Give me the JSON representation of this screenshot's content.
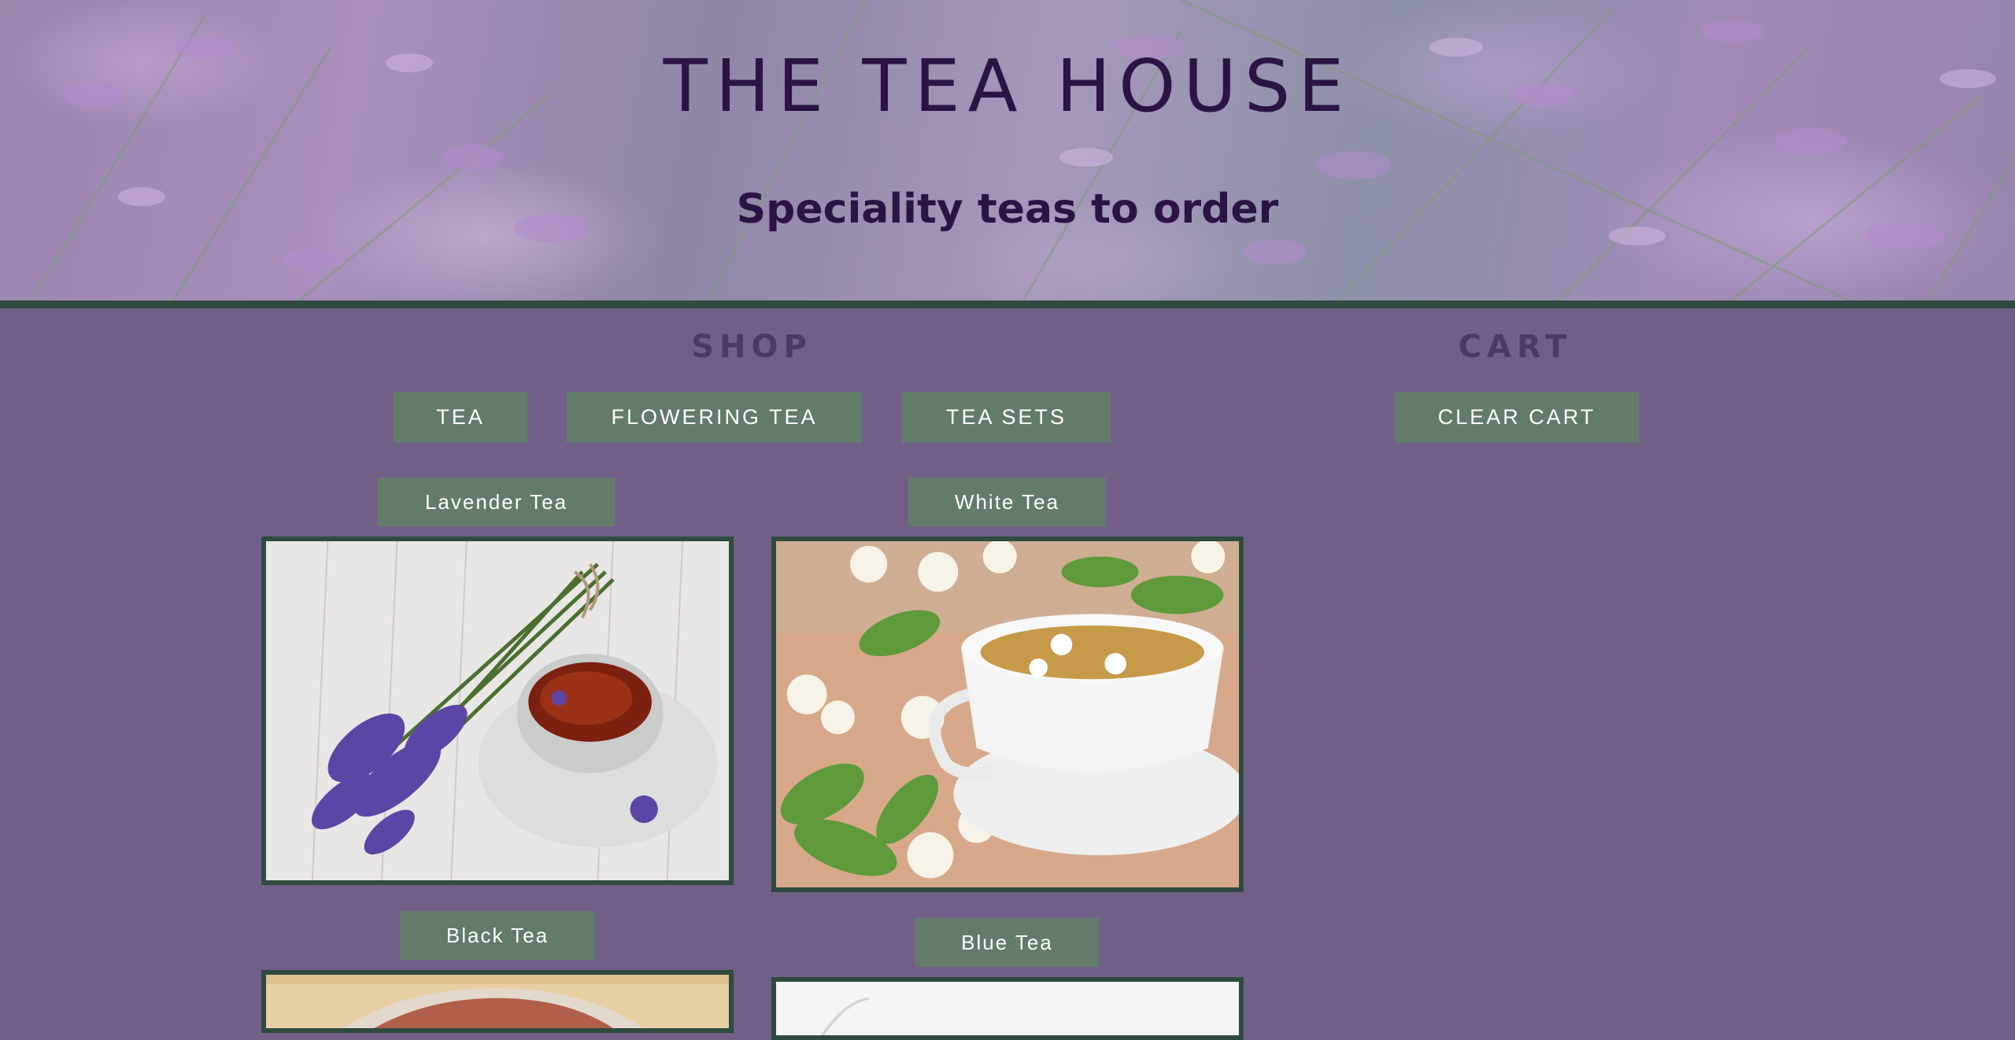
{
  "header": {
    "title": "THE TEA HOUSE",
    "subtitle": "Speciality teas to order"
  },
  "shop": {
    "heading": "SHOP",
    "categories": [
      {
        "label": "TEA"
      },
      {
        "label": "FLOWERING TEA"
      },
      {
        "label": "TEA SETS"
      }
    ],
    "products": [
      {
        "label": "Lavender Tea",
        "image": "lavender-tea-cup-photo"
      },
      {
        "label": "White Tea",
        "image": "jasmine-white-tea-cup-photo"
      },
      {
        "label": "Black Tea",
        "image": "black-tea-photo"
      },
      {
        "label": "Blue Tea",
        "image": "blue-tea-photo"
      }
    ]
  },
  "cart": {
    "heading": "CART",
    "clear_label": "CLEAR CART"
  },
  "colors": {
    "page_background": "#715f88",
    "button_background": "#637c6a",
    "border_green": "#2f4a3e",
    "title_color": "#2b1444"
  }
}
